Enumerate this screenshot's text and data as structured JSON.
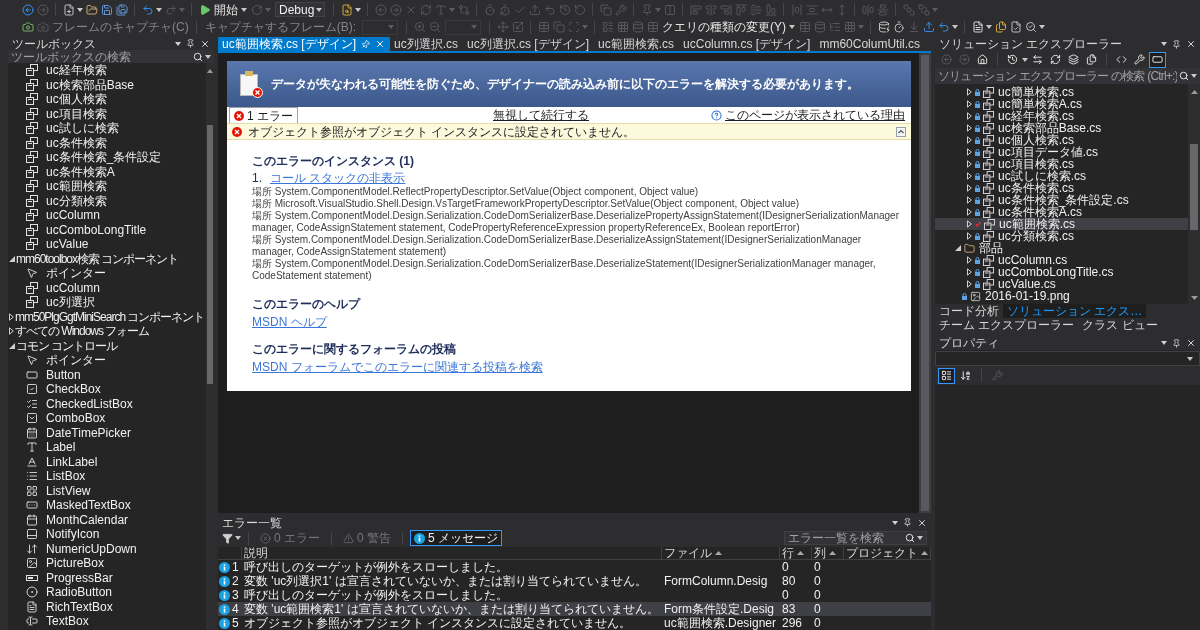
{
  "toolbar": {
    "row_1": [
      {
        "kind": "back",
        "disabled": false,
        "menu": false
      },
      {
        "kind": "forward",
        "disabled": true,
        "menu": false
      },
      {
        "kind": "separator"
      },
      {
        "kind": "new_project",
        "disabled": false,
        "menu": true
      },
      {
        "kind": "open",
        "disabled": false,
        "menu": false
      },
      {
        "kind": "save",
        "disabled": false,
        "menu": false
      },
      {
        "kind": "save_all",
        "disabled": false,
        "menu": false
      },
      {
        "kind": "separator"
      },
      {
        "kind": "undo",
        "disabled": false,
        "menu": true
      },
      {
        "kind": "redo",
        "disabled": true,
        "menu": true
      },
      {
        "kind": "separator"
      },
      {
        "kind": "start",
        "label": "開始",
        "disabled": false,
        "menu": true
      },
      {
        "kind": "restart",
        "disabled": true,
        "menu": true
      },
      {
        "kind": "configuration",
        "value": "Debug"
      },
      {
        "kind": "separator"
      },
      {
        "kind": "find",
        "disabled": false,
        "menu": true
      },
      {
        "kind": "separator"
      },
      {
        "kind": "nav_back",
        "disabled": true,
        "menu": false
      },
      {
        "kind": "nav_forward",
        "disabled": true,
        "menu": false
      },
      {
        "kind": "stop",
        "disabled": true,
        "menu": false
      },
      {
        "kind": "reload",
        "disabled": true,
        "menu": false
      },
      {
        "kind": "font",
        "disabled": true,
        "menu": true
      },
      {
        "kind": "compare",
        "disabled": true,
        "menu": false
      },
      {
        "kind": "separator"
      },
      {
        "kind": "timer",
        "disabled": true,
        "menu": false
      },
      {
        "kind": "timer_reset",
        "disabled": true,
        "menu": false
      },
      {
        "kind": "check",
        "disabled": true,
        "menu": false
      },
      {
        "kind": "upload",
        "disabled": true,
        "menu": false
      },
      {
        "kind": "undo",
        "disabled": true,
        "menu": false
      },
      {
        "kind": "history",
        "disabled": true,
        "menu": false
      },
      {
        "kind": "rotate",
        "disabled": true,
        "menu": false
      },
      {
        "kind": "separator"
      },
      {
        "kind": "copy",
        "disabled": true,
        "menu": false
      },
      {
        "kind": "wrench",
        "disabled": true,
        "menu": false
      },
      {
        "kind": "separator"
      },
      {
        "kind": "pin",
        "disabled": true,
        "menu": true
      },
      {
        "kind": "columns",
        "disabled": true,
        "menu": false
      },
      {
        "kind": "separator"
      },
      {
        "kind": "align_left",
        "disabled": true,
        "menu": false
      },
      {
        "kind": "align_center",
        "disabled": true,
        "menu": false
      },
      {
        "kind": "align_right",
        "disabled": true,
        "menu": false
      },
      {
        "kind": "align_top",
        "disabled": true,
        "menu": false
      },
      {
        "kind": "align_middle",
        "disabled": true,
        "menu": false
      },
      {
        "kind": "align_bottom",
        "disabled": true,
        "menu": false
      },
      {
        "kind": "separator"
      },
      {
        "kind": "space_h",
        "disabled": true,
        "menu": false
      },
      {
        "kind": "space_v",
        "disabled": true,
        "menu": false
      },
      {
        "kind": "size_w",
        "disabled": true,
        "menu": false
      },
      {
        "kind": "size_h",
        "disabled": true,
        "menu": false
      },
      {
        "kind": "separator"
      },
      {
        "kind": "center_h",
        "disabled": true,
        "menu": false
      },
      {
        "kind": "center_v",
        "disabled": true,
        "menu": false
      },
      {
        "kind": "separator"
      },
      {
        "kind": "bring_front",
        "disabled": true,
        "menu": false
      },
      {
        "kind": "send_back",
        "disabled": true,
        "menu": true
      }
    ],
    "row_2": [
      {
        "kind": "capture",
        "disabled": false,
        "menu": false
      },
      {
        "kind": "capture_frame",
        "label": "フレームのキャプチャ(C)",
        "disabled": true,
        "menu": false
      },
      {
        "kind": "separator"
      },
      {
        "kind": "label",
        "label": "キャプチャするフレーム(B):",
        "disabled": true
      },
      {
        "kind": "combo",
        "disabled": true
      },
      {
        "kind": "separator"
      },
      {
        "kind": "zoom_in",
        "disabled": true,
        "menu": false
      },
      {
        "kind": "zoom_out",
        "disabled": true,
        "menu": false
      },
      {
        "kind": "combo",
        "disabled": true
      },
      {
        "kind": "separator"
      },
      {
        "kind": "move",
        "disabled": true,
        "menu": false
      },
      {
        "kind": "resize",
        "disabled": true,
        "menu": false
      },
      {
        "kind": "separator"
      },
      {
        "kind": "table",
        "disabled": true,
        "menu": false
      },
      {
        "kind": "copy",
        "disabled": true,
        "menu": false
      },
      {
        "kind": "select_region",
        "disabled": true,
        "menu": true
      },
      {
        "kind": "separator"
      },
      {
        "kind": "layout",
        "disabled": true,
        "menu": false
      },
      {
        "kind": "grid",
        "disabled": true,
        "menu": false
      },
      {
        "kind": "database",
        "disabled": true,
        "menu": false
      },
      {
        "kind": "table",
        "disabled": true,
        "menu": false
      },
      {
        "kind": "query_type",
        "label": "クエリの種類の変更(Y)",
        "disabled": false,
        "menu": true
      },
      {
        "kind": "table",
        "disabled": true,
        "menu": false
      },
      {
        "kind": "database",
        "disabled": true,
        "menu": false
      },
      {
        "kind": "list_tree",
        "disabled": true,
        "menu": false
      },
      {
        "kind": "grid",
        "disabled": true,
        "menu": true
      },
      {
        "kind": "separator"
      },
      {
        "kind": "data_compare",
        "disabled": false,
        "menu": false
      },
      {
        "kind": "timer",
        "disabled": false,
        "menu": false
      },
      {
        "kind": "download",
        "disabled": true,
        "menu": false
      },
      {
        "kind": "upload",
        "disabled": false,
        "menu": false
      },
      {
        "kind": "undo",
        "disabled": false,
        "menu": true
      },
      {
        "kind": "separator"
      },
      {
        "kind": "new_file",
        "disabled": false,
        "menu": true
      },
      {
        "kind": "file_copy",
        "disabled": false,
        "menu": false
      },
      {
        "kind": "file_check",
        "disabled": false,
        "menu": false
      },
      {
        "kind": "search_db",
        "disabled": false,
        "menu": true
      }
    ]
  },
  "toolbox": {
    "title": "ツールボックス",
    "search": {
      "placeholder": "ツールボックスの検索"
    },
    "items": [
      {
        "kind": "user_control",
        "label": "uc経年検索"
      },
      {
        "kind": "user_control",
        "label": "uc検索部品Base"
      },
      {
        "kind": "user_control",
        "label": "uc個人検索"
      },
      {
        "kind": "user_control",
        "label": "uc項目検索"
      },
      {
        "kind": "user_control",
        "label": "uc試しに検索"
      },
      {
        "kind": "user_control",
        "label": "uc条件検索"
      },
      {
        "kind": "user_control",
        "label": "uc条件検索_条件設定"
      },
      {
        "kind": "user_control",
        "label": "uc条件検索A"
      },
      {
        "kind": "user_control",
        "label": "uc範囲検索"
      },
      {
        "kind": "user_control",
        "label": "uc分類検索"
      },
      {
        "kind": "user_control",
        "label": "ucColumn"
      },
      {
        "kind": "user_control",
        "label": "ucComboLongTitle"
      },
      {
        "kind": "user_control",
        "label": "ucValue"
      },
      {
        "kind": "group",
        "label": "mm60toolbox検索 コンポーネント",
        "expanded": true,
        "children": [
          {
            "kind": "pointer",
            "label": "ポインター"
          },
          {
            "kind": "user_control",
            "label": "ucColumn"
          },
          {
            "kind": "user_control",
            "label": "uc列選択"
          }
        ]
      },
      {
        "kind": "group",
        "label": "mm50PlgGgtMiniSearch コンポーネント",
        "expanded": false
      },
      {
        "kind": "group",
        "label": "すべての Windows フォーム",
        "expanded": false
      },
      {
        "kind": "group",
        "label": "コモン コントロール",
        "expanded": true,
        "children": [
          {
            "kind": "pointer",
            "label": "ポインター"
          },
          {
            "kind": "button",
            "label": "Button"
          },
          {
            "kind": "check_box",
            "label": "CheckBox"
          },
          {
            "kind": "checked_list_box",
            "label": "CheckedListBox"
          },
          {
            "kind": "combo_box",
            "label": "ComboBox"
          },
          {
            "kind": "date_time_picker",
            "label": "DateTimePicker"
          },
          {
            "kind": "label",
            "label": "Label"
          },
          {
            "kind": "link_label",
            "label": "LinkLabel"
          },
          {
            "kind": "list_box",
            "label": "ListBox"
          },
          {
            "kind": "list_view",
            "label": "ListView"
          },
          {
            "kind": "masked_text_box",
            "label": "MaskedTextBox"
          },
          {
            "kind": "month_calendar",
            "label": "MonthCalendar"
          },
          {
            "kind": "notify_icon",
            "label": "NotifyIcon"
          },
          {
            "kind": "numeric_up_down",
            "label": "NumericUpDown"
          },
          {
            "kind": "picture_box",
            "label": "PictureBox"
          },
          {
            "kind": "progress_bar",
            "label": "ProgressBar"
          },
          {
            "kind": "radio_button",
            "label": "RadioButton"
          },
          {
            "kind": "rich_text_box",
            "label": "RichTextBox"
          },
          {
            "kind": "text_box",
            "label": "TextBox"
          }
        ]
      }
    ]
  },
  "document_tabs": [
    {
      "label": "uc範囲検索.cs [デザイン]",
      "selected": true
    },
    {
      "label": "uc列選択.cs",
      "selected": false
    },
    {
      "label": "uc列選択.cs [デザイン]",
      "selected": false
    },
    {
      "label": "uc範囲検索.cs",
      "selected": false
    },
    {
      "label": "ucColumn.cs [デザイン]",
      "selected": false
    },
    {
      "label": "mm60ColumUtil.cs",
      "selected": false
    }
  ],
  "designer": {
    "banner": {
      "message": "データが失なわれる可能性を防ぐため、デザイナーの読み込み前に以下のエラーを解決する必要があります。"
    },
    "error_tab": {
      "label": "1 エラー",
      "selected": true
    },
    "ignore_link": "無視して続行する",
    "why_link": "このページが表示されている理由",
    "error": {
      "message": "オブジェクト参照がオブジェクト インスタンスに設定されていません。",
      "expanded": true
    },
    "instances": {
      "heading": "このエラーのインスタンス (1)",
      "number": "1.",
      "toggle_link": "コール スタックの非表示",
      "stack": [
        "場所 System.ComponentModel.ReflectPropertyDescriptor.SetValue(Object component, Object value)",
        "場所 Microsoft.VisualStudio.Shell.Design.VsTargetFrameworkPropertyDescriptor.SetValue(Object component, Object value)",
        "場所 System.ComponentModel.Design.Serialization.CodeDomSerializerBase.DeserializePropertyAssignStatement(IDesignerSerializationManager manager, CodeAssignStatement statement, CodePropertyReferenceExpression propertyReferenceEx, Boolean reportError)",
        "場所 System.ComponentModel.Design.Serialization.CodeDomSerializerBase.DeserializeAssignStatement(IDesignerSerializationManager manager, CodeAssignStatement statement)",
        "場所 System.ComponentModel.Design.Serialization.CodeDomSerializerBase.DeserializeStatement(IDesignerSerializationManager manager, CodeStatement statement)"
      ]
    },
    "help": {
      "heading": "このエラーのヘルプ",
      "link": "MSDN ヘルプ"
    },
    "forum": {
      "heading": "このエラーに関するフォーラムの投稿",
      "link": "MSDN フォーラムでこのエラーに関連する投稿を検索"
    }
  },
  "error_list": {
    "title": "エラー一覧",
    "filters": [
      {
        "kind": "error",
        "label": "0 エラー",
        "selected": false,
        "disabled": true
      },
      {
        "kind": "warning",
        "label": "0 警告",
        "selected": false,
        "disabled": true
      },
      {
        "kind": "message",
        "label": "5 メッセージ",
        "selected": true,
        "disabled": false
      }
    ],
    "search": {
      "placeholder": "エラー一覧を検索"
    },
    "columns": [
      {
        "label": "説明",
        "sorted": false
      },
      {
        "label": "ファイル",
        "sorted": true
      },
      {
        "label": "行",
        "sorted": true
      },
      {
        "label": "列",
        "sorted": true
      },
      {
        "label": "プロジェクト",
        "sorted": true
      }
    ],
    "rows": [
      {
        "kind": "message",
        "number": "1",
        "description": "呼び出しのターゲットが例外をスローしました。",
        "line": "0",
        "column": "0",
        "selected": false
      },
      {
        "kind": "message",
        "number": "2",
        "description": "変数 'uc列選択1' は宣言されていないか、または割り当てられていません。",
        "file": "FormColumn.Desig",
        "line": "80",
        "column": "0",
        "selected": false
      },
      {
        "kind": "message",
        "number": "3",
        "description": "呼び出しのターゲットが例外をスローしました。",
        "line": "0",
        "column": "0",
        "selected": false
      },
      {
        "kind": "message",
        "number": "4",
        "description": "変数 'uc範囲検索1' は宣言されていないか、または割り当てられていません。",
        "file": "Form条件設定.Desig",
        "line": "83",
        "column": "0",
        "selected": true
      },
      {
        "kind": "message",
        "number": "5",
        "description": "オブジェクト参照がオブジェクト インスタンスに設定されていません。",
        "file": "uc範囲検索.Designer",
        "line": "296",
        "column": "0",
        "selected": false
      }
    ]
  },
  "solution_explorer": {
    "title": "ソリューション エクスプローラー",
    "toolbar": [
      {
        "kind": "back",
        "disabled": true,
        "selected": false,
        "menu": false
      },
      {
        "kind": "forward",
        "disabled": true,
        "selected": false,
        "menu": false
      },
      {
        "kind": "home",
        "disabled": false,
        "selected": false,
        "menu": false
      },
      {
        "kind": "separator"
      },
      {
        "kind": "pending_changes",
        "disabled": false,
        "selected": false,
        "menu": true
      },
      {
        "kind": "sync",
        "disabled": false,
        "selected": false,
        "menu": false
      },
      {
        "kind": "refresh",
        "disabled": false,
        "selected": false,
        "menu": false
      },
      {
        "kind": "collapse_all",
        "disabled": false,
        "selected": false,
        "menu": false
      },
      {
        "kind": "show_all_files",
        "disabled": false,
        "selected": false,
        "menu": false
      },
      {
        "kind": "separator"
      },
      {
        "kind": "view_code",
        "disabled": false,
        "selected": false,
        "menu": false
      },
      {
        "kind": "properties",
        "disabled": false,
        "selected": false,
        "menu": false
      },
      {
        "kind": "preview",
        "disabled": false,
        "selected": true,
        "menu": false
      }
    ],
    "search": {
      "placeholder": "ソリューション エクスプローラー の検索 (Ctrl+:)"
    },
    "items": [
      {
        "kind": "user_control",
        "label": "uc簡単検索.cs",
        "checked_out": false,
        "expanded": false,
        "selected": false
      },
      {
        "kind": "user_control",
        "label": "uc簡単検索A.cs",
        "checked_out": false,
        "expanded": false,
        "selected": false
      },
      {
        "kind": "user_control",
        "label": "uc経年検索.cs",
        "checked_out": false,
        "expanded": false,
        "selected": false
      },
      {
        "kind": "user_control",
        "label": "uc検索部品Base.cs",
        "checked_out": false,
        "expanded": false,
        "selected": false
      },
      {
        "kind": "user_control",
        "label": "uc個人検索.cs",
        "checked_out": false,
        "expanded": false,
        "selected": false
      },
      {
        "kind": "user_control",
        "label": "uc項目データ値.cs",
        "checked_out": false,
        "expanded": false,
        "selected": false
      },
      {
        "kind": "user_control",
        "label": "uc項目検索.cs",
        "checked_out": false,
        "expanded": false,
        "selected": false
      },
      {
        "kind": "user_control",
        "label": "uc試しに検索.cs",
        "checked_out": false,
        "expanded": false,
        "selected": false
      },
      {
        "kind": "user_control",
        "label": "uc条件検索.cs",
        "checked_out": false,
        "expanded": false,
        "selected": false
      },
      {
        "kind": "user_control",
        "label": "uc条件検索_条件設定.cs",
        "checked_out": false,
        "expanded": false,
        "selected": false
      },
      {
        "kind": "user_control",
        "label": "uc条件検索A.cs",
        "checked_out": false,
        "expanded": false,
        "selected": false
      },
      {
        "kind": "user_control",
        "label": "uc範囲検索.cs",
        "checked_out": true,
        "expanded": false,
        "selected": true
      },
      {
        "kind": "user_control",
        "label": "uc分類検索.cs",
        "checked_out": false,
        "expanded": false,
        "selected": false
      },
      {
        "kind": "folder",
        "label": "部品",
        "expanded": true,
        "selected": false,
        "children": [
          {
            "kind": "user_control",
            "label": "ucColumn.cs",
            "checked_out": false,
            "expanded": false,
            "selected": false
          },
          {
            "kind": "user_control",
            "label": "ucComboLongTitle.cs",
            "checked_out": false,
            "expanded": false,
            "selected": false
          },
          {
            "kind": "user_control",
            "label": "ucValue.cs",
            "checked_out": false,
            "expanded": false,
            "selected": false
          }
        ]
      },
      {
        "kind": "image",
        "label": "2016-01-19.png",
        "checked_out": false,
        "selected": false
      }
    ],
    "panel_tabs": [
      {
        "label": "コード分析",
        "selected": false
      },
      {
        "label": "ソリューション エクス…",
        "selected": true
      },
      {
        "label": "チーム エクスプローラー",
        "selected": false
      },
      {
        "label": "クラス ビュー",
        "selected": false
      }
    ]
  },
  "properties": {
    "title": "プロパティ",
    "toolbar": [
      {
        "kind": "categorized",
        "disabled": false,
        "selected": true,
        "menu": false
      },
      {
        "kind": "alphabetical",
        "disabled": false,
        "selected": false,
        "menu": false
      },
      {
        "kind": "separator"
      },
      {
        "kind": "property_pages",
        "disabled": true,
        "selected": false,
        "menu": false
      }
    ]
  }
}
